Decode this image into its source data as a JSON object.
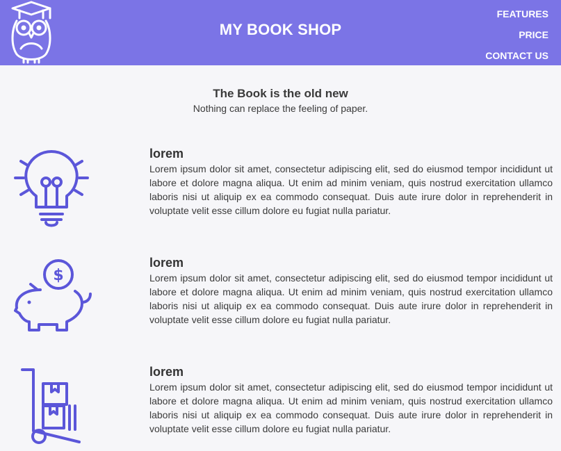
{
  "header": {
    "title": "MY BOOK SHOP",
    "nav": [
      "FEATURES",
      "PRICE",
      "CONTACT US"
    ],
    "logo_icon": "owl-graduate-icon",
    "color": "#7b74e6"
  },
  "hero": {
    "title": "The Book is the old new",
    "subtitle": "Nothing can replace the feeling of paper."
  },
  "features": [
    {
      "icon": "lightbulb-icon",
      "title": "lorem",
      "text": "Lorem ipsum dolor sit amet, consectetur adipiscing elit, sed do eiusmod tempor incididunt ut labore et dolore magna aliqua. Ut enim ad minim veniam, quis nostrud exercitation ullamco laboris nisi ut aliquip ex ea commodo consequat. Duis aute irure dolor in reprehenderit in voluptate velit esse cillum dolore eu fugiat nulla pariatur."
    },
    {
      "icon": "piggy-bank-icon",
      "title": "lorem",
      "text": "Lorem ipsum dolor sit amet, consectetur adipiscing elit, sed do eiusmod tempor incididunt ut labore et dolore magna aliqua. Ut enim ad minim veniam, quis nostrud exercitation ullamco laboris nisi ut aliquip ex ea commodo consequat. Duis aute irure dolor in reprehenderit in voluptate velit esse cillum dolore eu fugiat nulla pariatur."
    },
    {
      "icon": "hand-truck-boxes-icon",
      "title": "lorem",
      "text": "Lorem ipsum dolor sit amet, consectetur adipiscing elit, sed do eiusmod tempor incididunt ut labore et dolore magna aliqua. Ut enim ad minim veniam, quis nostrud exercitation ullamco laboris nisi ut aliquip ex ea commodo consequat. Duis aute irure dolor in reprehenderit in voluptate velit esse cillum dolore eu fugiat nulla pariatur."
    }
  ],
  "icon_color": "#5b56d9"
}
